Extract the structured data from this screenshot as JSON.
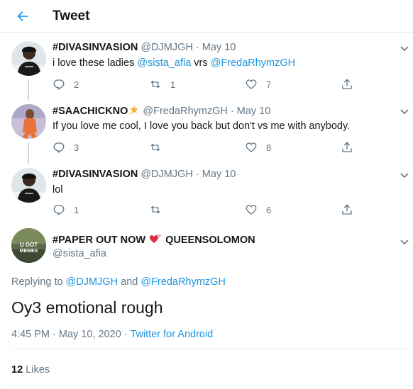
{
  "header": {
    "title": "Tweet",
    "back_icon": "arrow-left-icon"
  },
  "colors": {
    "accent": "#1da1f2",
    "link": "#1b95e0",
    "text": "#14171a",
    "muted": "#657786",
    "heart_emoji": "#e0245e",
    "star_emoji": "#ffac33"
  },
  "thread": [
    {
      "name": "#DIVASINVASION",
      "handle": "@DJMJGH",
      "sep": "·",
      "date": "May 10",
      "text_before": "i love these ladies ",
      "mention1": "@sista_afia",
      "text_middle": " vrs ",
      "mention2": "@FredaRhymzGH",
      "replies": "2",
      "retweets": "1",
      "likes": "7"
    },
    {
      "name": "#SAACHICKNO",
      "emoji": "dizzy-star",
      "handle": "@FredaRhymzGH",
      "sep": "·",
      "date": "May 10",
      "text": "If you love me cool, I love you back but don't vs me with anybody.",
      "replies": "3",
      "retweets": "",
      "likes": "8"
    },
    {
      "name": "#DIVASINVASION",
      "handle": "@DJMJGH",
      "sep": "·",
      "date": "May 10",
      "text": "lol",
      "replies": "1",
      "retweets": "",
      "likes": "6"
    }
  ],
  "main_tweet": {
    "name_part1": "#PAPER OUT NOW",
    "name_emoji": "two-hearts",
    "name_part2": "QUEENSOLOMON",
    "handle": "@sista_afia",
    "avatar_text": "U GOT MEMES",
    "replying_prefix": "Replying to ",
    "replying_user1": "@DJMJGH",
    "replying_and": " and ",
    "replying_user2": "@FredaRhymzGH",
    "text": "Oy3 emotional rough",
    "time": "4:45 PM",
    "sep": " · ",
    "date": "May 10, 2020",
    "source": "Twitter for Android",
    "likes_count": "12",
    "likes_label": "Likes"
  }
}
